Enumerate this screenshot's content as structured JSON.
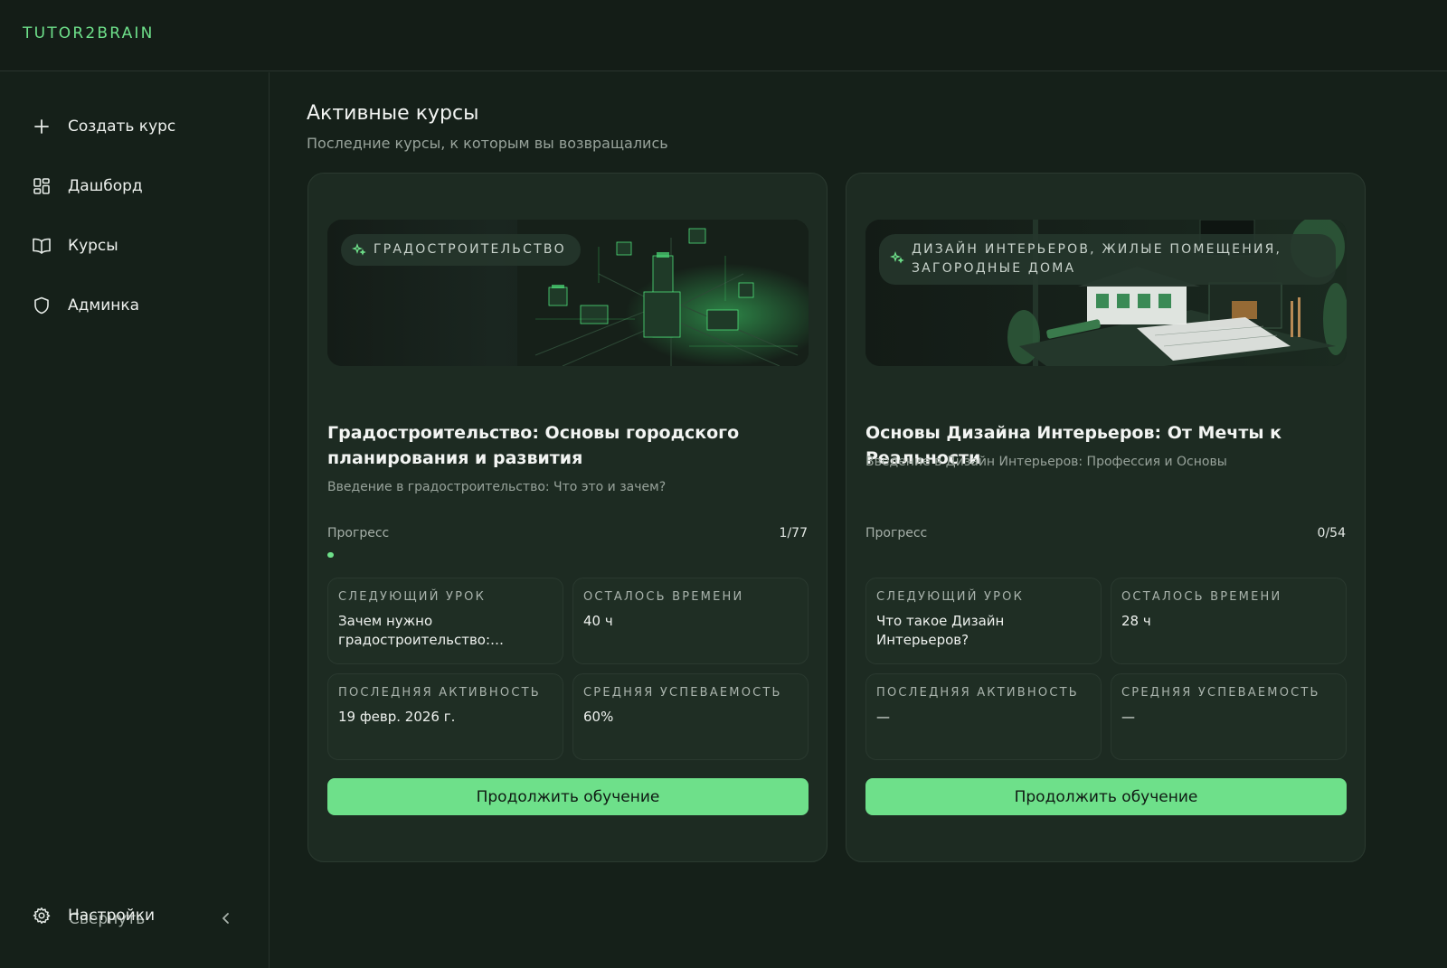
{
  "app": {
    "logo": "TUTOR2BRAIN"
  },
  "sidebar": {
    "items": [
      {
        "label": "Создать курс",
        "icon": "plus-icon"
      },
      {
        "label": "Дашборд",
        "icon": "dashboard-icon"
      },
      {
        "label": "Курсы",
        "icon": "book-icon"
      },
      {
        "label": "Админка",
        "icon": "shield-icon"
      }
    ],
    "collapse_label": "Свернуть",
    "settings_label": "Настройки"
  },
  "main": {
    "title": "Активные курсы",
    "subtitle": "Последние курсы, к которым вы возвращались"
  },
  "courses": [
    {
      "tag": "Градостроительство",
      "title": "Градостроительство: Основы городского планирования и развития",
      "subtitle": "Введение в градостроительство: Что это и зачем?",
      "progress_label": "Прогресс",
      "progress_count": "1/77",
      "progress_fraction": 0.013,
      "next_lesson_label": "СЛЕДУЮЩИЙ УРОК",
      "next_lesson": "Зачем нужно градостроительство: Влияние на жизнь",
      "time_left_label": "ОСТАЛОСЬ ВРЕМЕНИ",
      "time_left": "40 ч",
      "last_activity_label": "ПОСЛЕДНЯЯ АКТИВНОСТЬ",
      "last_activity": "19 февр. 2026 г.",
      "avg_score_label": "СРЕДНЯЯ УСПЕВАЕМОСТЬ",
      "avg_score": "60%",
      "button": "Продолжить обучение"
    },
    {
      "tag": "Дизайн интерьеров, жилые помещения, загородные дома",
      "title": "Основы Дизайна Интерьеров: От Мечты к Реальности",
      "subtitle": "Введение в Дизайн Интерьеров: Профессия и Основы",
      "progress_label": "Прогресс",
      "progress_count": "0/54",
      "progress_fraction": 0,
      "next_lesson_label": "СЛЕДУЮЩИЙ УРОК",
      "next_lesson": "Что такое Дизайн Интерьеров?",
      "time_left_label": "ОСТАЛОСЬ ВРЕМЕНИ",
      "time_left": "28 ч",
      "last_activity_label": "ПОСЛЕДНЯЯ АКТИВНОСТЬ",
      "last_activity": "—",
      "avg_score_label": "СРЕДНЯЯ УСПЕВАЕМОСТЬ",
      "avg_score": "—",
      "button": "Продолжить обучение"
    }
  ],
  "colors": {
    "accent": "#6ee08a",
    "background": "#152019",
    "card": "#1d2b22"
  }
}
